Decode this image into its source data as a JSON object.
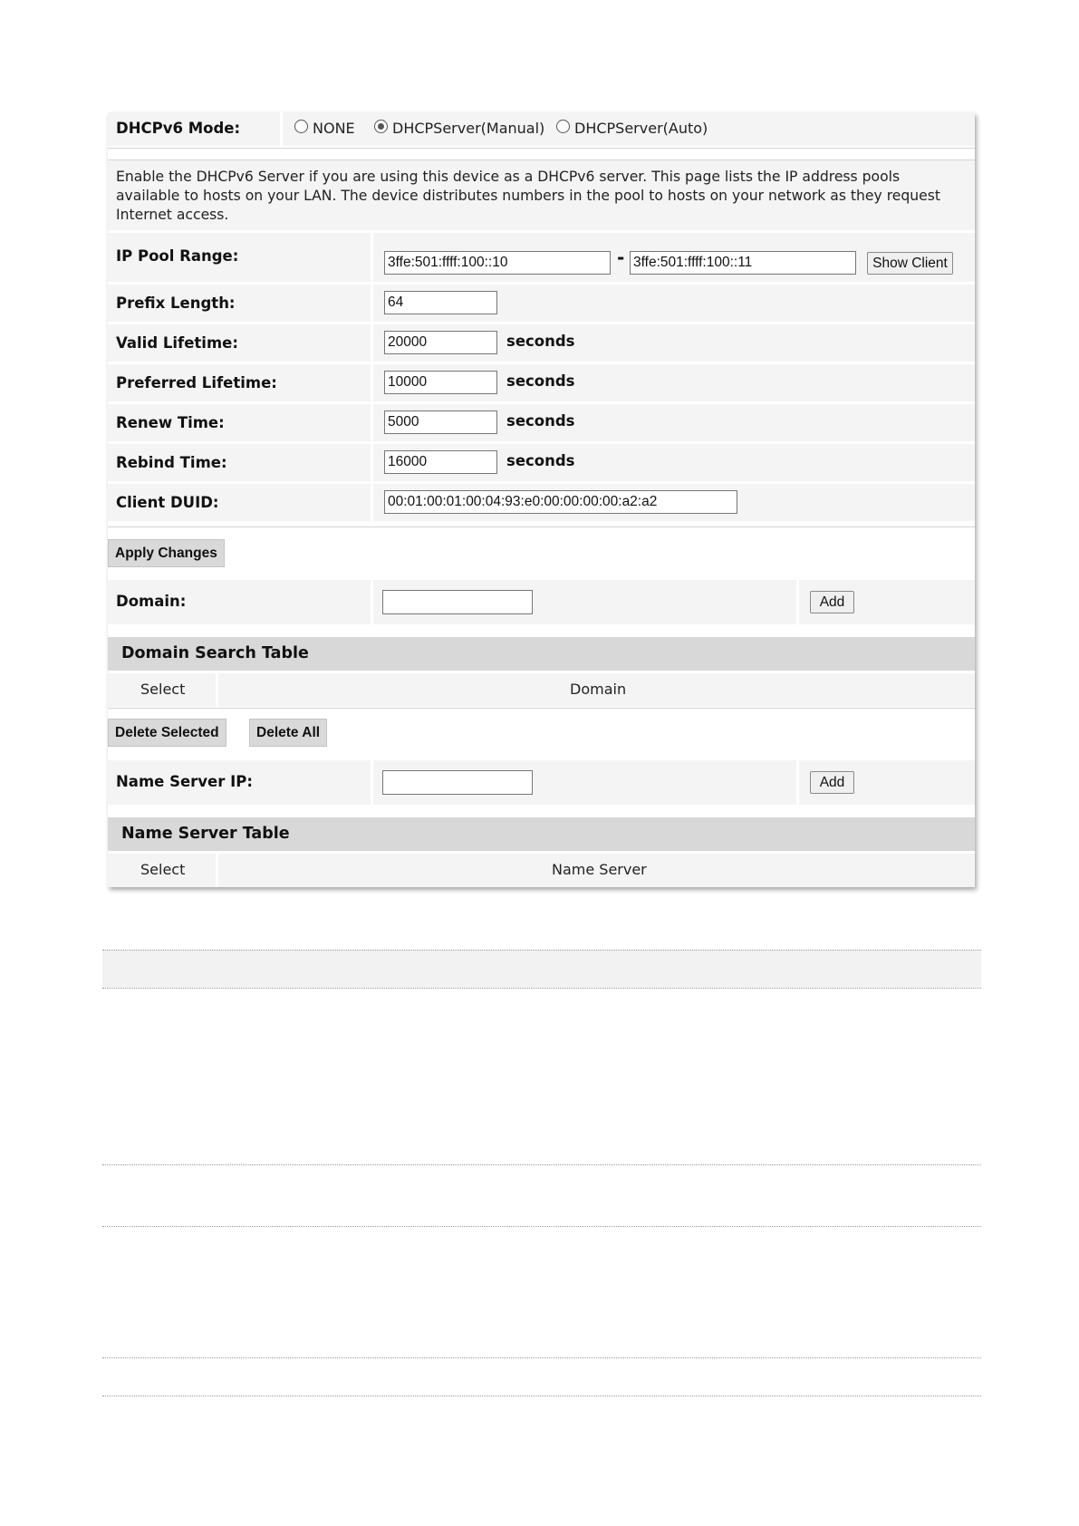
{
  "mode": {
    "label": "DHCPv6 Mode:",
    "options": [
      {
        "label": "NONE",
        "selected": false
      },
      {
        "label": "DHCPServer(Manual)",
        "selected": true
      },
      {
        "label": "DHCPServer(Auto)",
        "selected": false
      }
    ]
  },
  "description": "Enable the DHCPv6 Server if you are using this device as a DHCPv6 server. This page lists the IP address pools available to hosts on your LAN. The device distributes numbers in the pool to hosts on your network as they request Internet access.",
  "ip_pool": {
    "label": "IP Pool Range:",
    "start": "3ffe:501:ffff:100::10",
    "separator": "-",
    "end": "3ffe:501:ffff:100::11",
    "show_client_button": "Show Client"
  },
  "fields": {
    "prefix_length": {
      "label": "Prefix Length:",
      "value": "64"
    },
    "valid_lifetime": {
      "label": "Valid Lifetime:",
      "value": "20000",
      "unit": "seconds"
    },
    "preferred_lifetime": {
      "label": "Preferred Lifetime:",
      "value": "10000",
      "unit": "seconds"
    },
    "renew_time": {
      "label": "Renew Time:",
      "value": "5000",
      "unit": "seconds"
    },
    "rebind_time": {
      "label": "Rebind Time:",
      "value": "16000",
      "unit": "seconds"
    },
    "client_duid": {
      "label": "Client DUID:",
      "value": "00:01:00:01:00:04:93:e0:00:00:00:00:a2:a2"
    }
  },
  "apply_button": "Apply Changes",
  "domain": {
    "label": "Domain:",
    "value": "",
    "add_button": "Add"
  },
  "domain_table": {
    "title": "Domain Search Table",
    "columns": [
      "Select",
      "Domain"
    ],
    "delete_selected_button": "Delete Selected",
    "delete_all_button": "Delete All"
  },
  "name_server": {
    "label": "Name Server IP:",
    "value": "",
    "add_button": "Add"
  },
  "name_server_table": {
    "title": "Name Server Table",
    "columns": [
      "Select",
      "Name Server"
    ]
  },
  "colors": {
    "row_bg": "#f4f4f4",
    "section_header_bg": "#d8d8d8",
    "button_bg": "#d9d9d9"
  }
}
